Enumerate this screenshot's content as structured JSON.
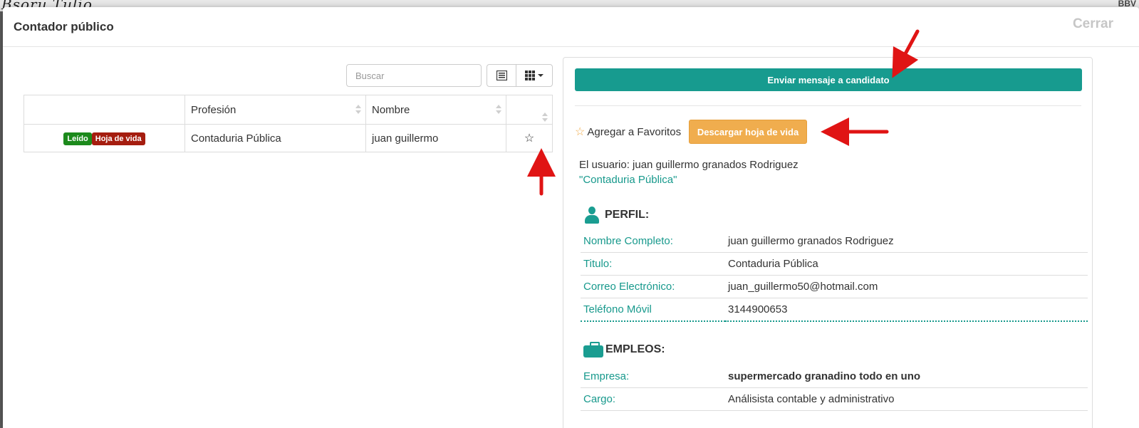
{
  "background": {
    "script_text": "Bsoru Tulio",
    "corner_text": "BBV"
  },
  "modal": {
    "title": "Contador público",
    "close_label": "Cerrar"
  },
  "search": {
    "placeholder": "Buscar"
  },
  "table": {
    "columns": [
      "",
      "Profesión",
      "Nombre",
      ""
    ],
    "rows": [
      {
        "badges": [
          "Leído",
          "Hoja de vida"
        ],
        "profesion": "Contaduria Pública",
        "nombre": "juan guillermo"
      }
    ]
  },
  "panel": {
    "send_message_label": "Enviar mensaje a candidato",
    "favorite_label": "Agregar a Favoritos",
    "download_cv_label": "Descargar hoja de vida",
    "user_line": "El usuario: juan guillermo granados Rodriguez",
    "profession_line": "\"Contaduria Pública\"",
    "perfil": {
      "heading": "PERFIL:",
      "rows": [
        {
          "label": "Nombre Completo:",
          "value": "juan guillermo granados Rodriguez"
        },
        {
          "label": "Titulo:",
          "value": "Contaduria Pública"
        },
        {
          "label": "Correo Electrónico:",
          "value": "juan_guillermo50@hotmail.com"
        },
        {
          "label": "Teléfono Móvil",
          "value": "3144900653"
        }
      ]
    },
    "empleos": {
      "heading": "EMPLEOS:",
      "rows": [
        {
          "label": "Empresa:",
          "value": "supermercado granadino todo en uno"
        },
        {
          "label": "Cargo:",
          "value": "Análisista contable y administrativo"
        }
      ]
    }
  },
  "colors": {
    "teal": "#179b8f",
    "orange": "#f0ad4e",
    "badge_green": "#1c8a1c",
    "badge_red": "#a51d0f",
    "annotation_arrow": "#e01414"
  },
  "icons": [
    "list-view-icon",
    "grid-view-icon",
    "star-icon",
    "user-icon",
    "briefcase-icon",
    "sort-icon",
    "annotation-arrow"
  ]
}
